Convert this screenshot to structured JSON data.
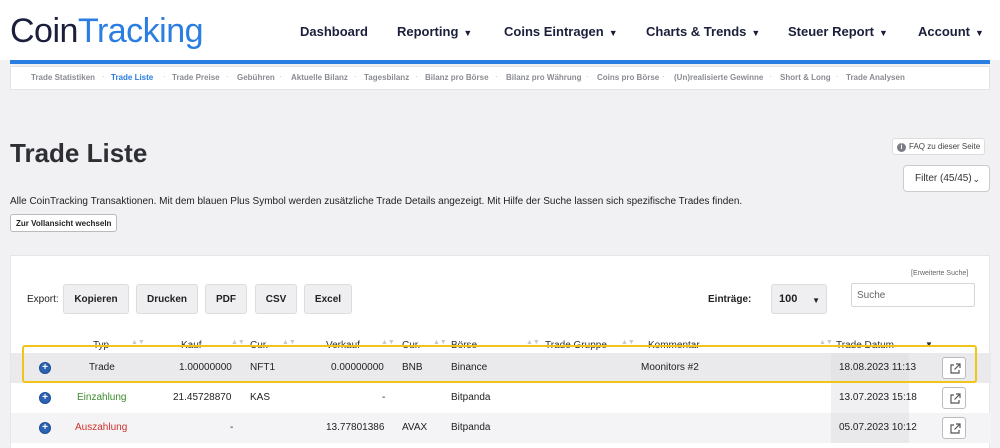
{
  "logo": {
    "part1": "Coin",
    "part2": "Tracking"
  },
  "nav": [
    {
      "label": "Dashboard",
      "caret": ""
    },
    {
      "label": "Reporting",
      "caret": "▼"
    },
    {
      "label": "Coins Eintragen",
      "caret": "▼"
    },
    {
      "label": "Charts & Trends",
      "caret": "▼"
    },
    {
      "label": "Steuer Report",
      "caret": "▼"
    },
    {
      "label": "Account",
      "caret": "▼"
    }
  ],
  "subnav": [
    {
      "label": "Trade Statistiken"
    },
    {
      "label": "Trade Liste",
      "active": true
    },
    {
      "label": "Trade Preise"
    },
    {
      "label": "Gebühren"
    },
    {
      "label": "Aktuelle Bilanz"
    },
    {
      "label": "Tagesbilanz"
    },
    {
      "label": "Bilanz pro Börse"
    },
    {
      "label": "Bilanz pro Währung"
    },
    {
      "label": "Coins pro Börse"
    },
    {
      "label": "(Un)realisierte Gewinne"
    },
    {
      "label": "Short & Long"
    },
    {
      "label": "Trade Analysen"
    }
  ],
  "subnav_separator": "·",
  "page": {
    "title": "Trade Liste",
    "faq": "FAQ zu dieser Seite",
    "filter": "Filter (45/45)",
    "description": "Alle CoinTracking Transaktionen. Mit dem blauen Plus Symbol werden zusätzliche Trade Details angezeigt. Mit Hilfe der Suche lassen sich spezifische Trades finden.",
    "full_view_button": "Zur Vollansicht wechseln"
  },
  "toolbar": {
    "extended_search": "[Erweiterte Suche]",
    "export_label": "Export:",
    "buttons": [
      "Kopieren",
      "Drucken",
      "PDF",
      "CSV",
      "Excel"
    ],
    "entries_label": "Einträge:",
    "entries_value": "100",
    "search_placeholder": "Suche"
  },
  "table": {
    "headers": [
      "Typ",
      "Kauf",
      "Cur.",
      "Verkauf",
      "Cur.",
      "Börse",
      "Trade Gruppe",
      "Kommentar",
      "Trade Datum"
    ],
    "rows": [
      {
        "type": "Trade",
        "type_color": "#222222",
        "buy": "1.00000000",
        "buy_cur": "NFT1",
        "sell": "0.00000000",
        "sell_cur": "BNB",
        "exchange": "Binance",
        "group": "",
        "comment": "Moonitors #2",
        "date": "18.08.2023 11:13"
      },
      {
        "type": "Einzahlung",
        "type_color": "#3b8a2e",
        "buy": "21.45728870",
        "buy_cur": "KAS",
        "sell": "-",
        "sell_cur": "",
        "exchange": "Bitpanda",
        "group": "",
        "comment": "",
        "date": "13.07.2023 15:18"
      },
      {
        "type": "Auszahlung",
        "type_color": "#d0312d",
        "buy": "-",
        "buy_cur": "",
        "sell": "13.77801386",
        "sell_cur": "AVAX",
        "exchange": "Bitpanda",
        "group": "",
        "comment": "",
        "date": "05.07.2023 10:12"
      }
    ]
  },
  "colors": {
    "brand_blue": "#2a7de1",
    "highlight": "#f0c419"
  }
}
